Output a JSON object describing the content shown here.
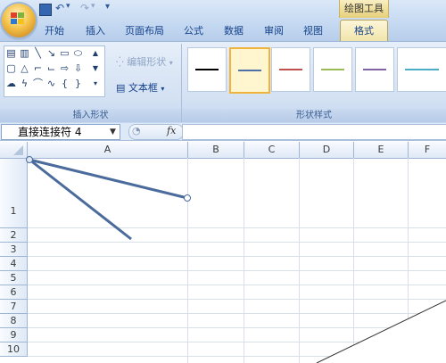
{
  "quick_access": {
    "undo_icon": "↶",
    "redo_icon": "↷",
    "dropdown_icon": "▾"
  },
  "contextual": {
    "group_label": "绘图工具"
  },
  "tabs": [
    {
      "label": "开始"
    },
    {
      "label": "插入"
    },
    {
      "label": "页面布局"
    },
    {
      "label": "公式"
    },
    {
      "label": "数据"
    },
    {
      "label": "审阅"
    },
    {
      "label": "视图"
    },
    {
      "label": "格式"
    }
  ],
  "ribbon": {
    "insert_shapes": {
      "label": "插入形状",
      "edit_shape": "编辑形状",
      "text_box": "文本框"
    },
    "shape_styles": {
      "label": "形状样式",
      "styles": [
        {
          "color": "#000000"
        },
        {
          "color": "#4f6fa8"
        },
        {
          "color": "#c0504d"
        },
        {
          "color": "#9bbb59"
        },
        {
          "color": "#8064a2"
        },
        {
          "color": "#4bacc6"
        }
      ]
    }
  },
  "formula_bar": {
    "name_box": "直接连接符 4",
    "fx": "fx",
    "formula": ""
  },
  "sheet": {
    "columns": [
      "A",
      "B",
      "C",
      "D",
      "E",
      "F"
    ],
    "rows": [
      "1",
      "2",
      "3",
      "4",
      "5",
      "6",
      "7",
      "8",
      "9",
      "10"
    ]
  }
}
